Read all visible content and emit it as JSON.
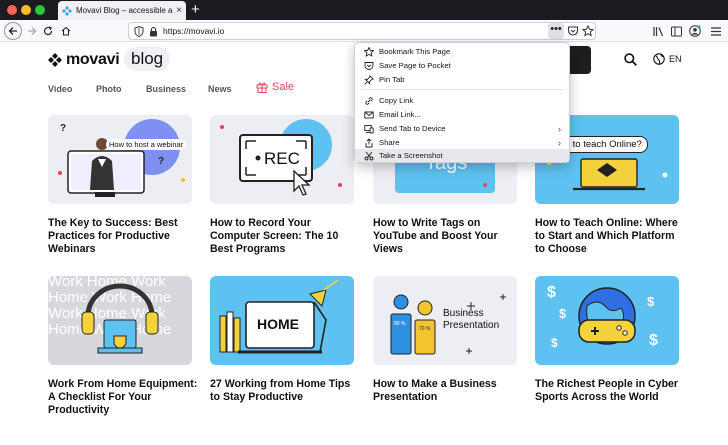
{
  "browser": {
    "tab_title": "Movavi Blog – accessible articles",
    "tab_close": "×",
    "new_tab": "+",
    "url": "https://movavi.io",
    "url_more": "•••"
  },
  "site": {
    "logo_text": "movavi",
    "blog_label": "blog",
    "language": "EN",
    "nav": [
      "Video",
      "Photo",
      "Business",
      "News"
    ],
    "sale_label": "Sale",
    "sale_color": "#e2445c"
  },
  "context_menu": {
    "items": [
      {
        "label": "Bookmark This Page",
        "icon": "star-icon"
      },
      {
        "label": "Save Page to Pocket",
        "icon": "pocket-icon"
      },
      {
        "label": "Pin Tab",
        "icon": "pin-icon"
      },
      {
        "label": "Copy Link",
        "icon": "link-icon"
      },
      {
        "label": "Email Link...",
        "icon": "email-icon"
      },
      {
        "label": "Send Tab to Device",
        "icon": "device-icon",
        "submenu": true
      },
      {
        "label": "Share",
        "icon": "share-icon",
        "submenu": true
      },
      {
        "label": "Take a Screenshot",
        "icon": "screenshot-icon",
        "highlighted": true
      }
    ],
    "chevron": "›"
  },
  "cards": [
    {
      "title": "The Key to Success: Best Practices for Productive Webinars",
      "image_text": "How to host a webinar",
      "accent": "#7b8cf5"
    },
    {
      "title": "How to Record Your Computer Screen: The 10 Best Programs",
      "image_text": "REC",
      "accent": "#5ec2f0"
    },
    {
      "title": "How to Write Tags on YouTube and Boost Your Views",
      "image_text": "Tags",
      "accent": "#5ec2f0"
    },
    {
      "title": "How to Teach Online: Where to Start and Which Platform to Choose",
      "image_text": "How to teach Online?",
      "accent": "#5ec2f0"
    },
    {
      "title": "Work From Home Equipment: A Checklist For Your Productivity",
      "image_text": "Work Home Work Home Work Home Work Home Work Home Work Home",
      "accent": "#e8e8ee"
    },
    {
      "title": "27 Working from Home Tips to Stay Productive",
      "image_text": "HOME",
      "accent": "#5ec2f0"
    },
    {
      "title": "How to Make a Business Presentation",
      "image_text": "Business Presentation",
      "accent": "#e8e8ee"
    },
    {
      "title": "The Richest People in Cyber Sports Across the World",
      "image_text": "$",
      "accent": "#5ec2f0"
    }
  ],
  "stats": {
    "chart_left": "80 %",
    "chart_right": "70 %"
  }
}
